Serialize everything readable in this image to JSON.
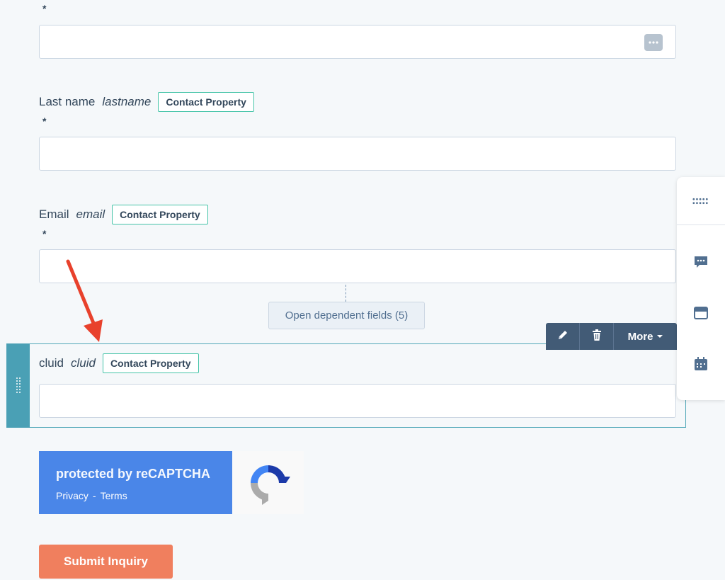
{
  "required_marker": "*",
  "fields": [
    {
      "label": "Last name",
      "internal_name": "lastname",
      "badge": "Contact Property"
    },
    {
      "label": "Email",
      "internal_name": "email",
      "badge": "Contact Property"
    },
    {
      "label": "cluid",
      "internal_name": "cluid",
      "badge": "Contact Property"
    }
  ],
  "dependent_fields_button": "Open dependent fields (5)",
  "toolbar": {
    "edit_icon": "pencil-icon",
    "delete_icon": "trash-icon",
    "more_label": "More"
  },
  "recaptcha": {
    "title": "protected by reCAPTCHA",
    "privacy": "Privacy",
    "separator": "-",
    "terms": "Terms"
  },
  "submit_label": "Submit Inquiry",
  "side_panel_icons": [
    "grid-dots-icon",
    "chat-icon",
    "layout-icon",
    "calendar-icon"
  ],
  "colors": {
    "accent_teal": "#4aa0b5",
    "badge_border": "#45c4a8",
    "submit": "#f07f5e",
    "toolbar": "#425b76",
    "annotation_arrow": "#e8412c",
    "recaptcha_blue": "#4a86e8"
  }
}
